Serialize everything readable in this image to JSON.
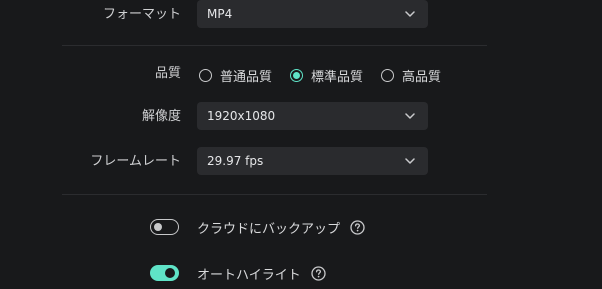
{
  "format": {
    "label": "フォーマット",
    "value": "MP4"
  },
  "quality": {
    "label": "品質",
    "options": [
      {
        "label": "普通品質",
        "selected": false
      },
      {
        "label": "標準品質",
        "selected": true
      },
      {
        "label": "高品質",
        "selected": false
      }
    ]
  },
  "resolution": {
    "label": "解像度",
    "value": "1920x1080"
  },
  "framerate": {
    "label": "フレームレート",
    "value": "29.97 fps"
  },
  "toggles": [
    {
      "label": "クラウドにバックアップ",
      "on": false
    },
    {
      "label": "オートハイライト",
      "on": true
    }
  ],
  "colors": {
    "accent": "#5fe3c7",
    "background": "#18191b",
    "field": "#2a2b2e"
  }
}
